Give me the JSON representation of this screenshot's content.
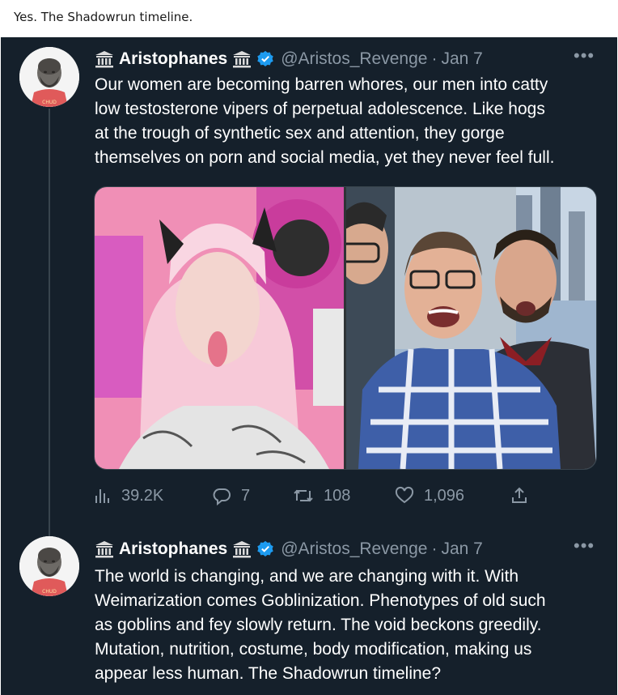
{
  "caption": "Yes. The Shadowrun timeline.",
  "tweets": [
    {
      "display_name": "Aristophanes",
      "handle": "@Aristos_Revenge",
      "separator": "·",
      "time": "Jan 7",
      "more": "•••",
      "text": "Our women are becoming barren whores, our men into catty\nlow testosterone vipers of perpetual adolescence. Like hogs\nat the trough of synthetic sex and attention, they gorge\nthemselves on porn and social media, yet they never feel full.",
      "stats": {
        "views": "39.2K",
        "replies": "7",
        "retweets": "108",
        "likes": "1,096"
      }
    },
    {
      "display_name": "Aristophanes",
      "handle": "@Aristos_Revenge",
      "separator": "·",
      "time": "Jan 7",
      "more": "•••",
      "text": "The world is changing, and we are changing with it. With\nWeimarization comes Goblinization. Phenotypes of old such\nas goblins and fey slowly return. The void beckons greedily.\nMutation, nutrition, costume, body modification, making us\nappear less human. The Shadowrun timeline?"
    }
  ],
  "icons": [
    "temple-icon",
    "verified-badge-icon",
    "views-icon",
    "reply-icon",
    "retweet-icon",
    "like-icon",
    "share-icon"
  ],
  "colors": {
    "background": "#15202b",
    "text": "#ffffff",
    "muted": "#8b98a5",
    "verified": "#1d9bf0"
  }
}
